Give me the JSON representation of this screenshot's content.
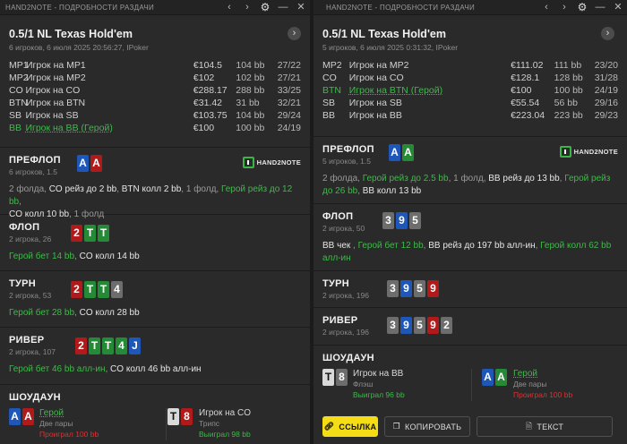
{
  "panels": [
    {
      "title": "HAND2NOTE - ПОДРОБНОСТИ РАЗДАЧИ",
      "game": "0.5/1 NL Texas Hold'em",
      "meta": "6 игроков, 6 июля 2025 20:56:27, IPoker",
      "players": [
        {
          "pos": "MP1",
          "name": "Игрок на MP1",
          "amount": "€104.5",
          "bb": "104 bb",
          "stats": "27/22",
          "hero": false
        },
        {
          "pos": "MP2",
          "name": "Игрок на MP2",
          "amount": "€102",
          "bb": "102 bb",
          "stats": "27/21",
          "hero": false
        },
        {
          "pos": "CO",
          "name": "Игрок на CO",
          "amount": "€288.17",
          "bb": "288 bb",
          "stats": "33/25",
          "hero": false
        },
        {
          "pos": "BTN",
          "name": "Игрок на BTN",
          "amount": "€31.42",
          "bb": "31 bb",
          "stats": "32/21",
          "hero": false
        },
        {
          "pos": "SB",
          "name": "Игрок на SB",
          "amount": "€103.75",
          "bb": "104 bb",
          "stats": "29/24",
          "hero": false
        },
        {
          "pos": "BB",
          "name": "Игрок на BB (Герой)",
          "amount": "€100",
          "bb": "100 bb",
          "stats": "24/19",
          "hero": true
        }
      ],
      "preflop": {
        "title": "ПРЕФЛОП",
        "sub": "6 игроков, 1.5",
        "logo": "HAND2NOTE",
        "hole": [
          "A",
          "A"
        ],
        "actions": [
          "2 фолда, ",
          "CO рейз до 2 bb",
          ", ",
          "BTN колл 2 bb",
          ", 1 фолд, ",
          "Герой рейз до 12 bb",
          ",",
          "CO колл 10 bb",
          ", 1 фолд"
        ]
      },
      "flop": {
        "title": "ФЛОП",
        "sub": "2 игрока, 26",
        "cards": [
          "2",
          "T",
          "T"
        ],
        "actions": [
          "Герой бет 14 bb",
          ", ",
          "CO колл 14 bb"
        ]
      },
      "turn": {
        "title": "ТУРН",
        "sub": "2 игрока, 53",
        "cards": [
          "2",
          "T",
          "T",
          "4"
        ],
        "actions": [
          "Герой бет 28 bb",
          ", ",
          "CO колл 28 bb"
        ]
      },
      "river": {
        "title": "РИВЕР",
        "sub": "2 игрока, 107",
        "cards": [
          "2",
          "T",
          "T",
          "4",
          "J"
        ],
        "actions": [
          "Герой бет 46 bb алл-ин",
          ", ",
          "CO колл 46 bb алл-ин"
        ]
      },
      "showdown": {
        "title": "ШОУДАУН",
        "p1": {
          "cards": [
            "A",
            "A"
          ],
          "name": "Герой",
          "combo": "Две пары",
          "result": "Проиграл 100 bb"
        },
        "p2": {
          "cards": [
            "T",
            "8"
          ],
          "name": "Игрок на CO",
          "combo": "Трипс",
          "result": "Выиграл 98 bb"
        }
      }
    },
    {
      "title": "HAND2NOTE - ПОДРОБНОСТИ РАЗДАЧИ",
      "game": "0.5/1 NL Texas Hold'em",
      "meta": "5 игроков, 6 июля 2025 0:31:32, IPoker",
      "players": [
        {
          "pos": "MP2",
          "name": "Игрок на MP2",
          "amount": "€111.02",
          "bb": "111 bb",
          "stats": "23/20",
          "hero": false
        },
        {
          "pos": "CO",
          "name": "Игрок на CO",
          "amount": "€128.1",
          "bb": "128 bb",
          "stats": "31/28",
          "hero": false
        },
        {
          "pos": "BTN",
          "name": "Игрок на BTN (Герой)",
          "amount": "€100",
          "bb": "100 bb",
          "stats": "24/19",
          "hero": true
        },
        {
          "pos": "SB",
          "name": "Игрок на SB",
          "amount": "€55.54",
          "bb": "56 bb",
          "stats": "29/16",
          "hero": false
        },
        {
          "pos": "BB",
          "name": "Игрок на BB",
          "amount": "€223.04",
          "bb": "223 bb",
          "stats": "29/23",
          "hero": false
        }
      ],
      "preflop": {
        "title": "ПРЕФЛОП",
        "sub": "5 игроков, 1.5",
        "logo": "HAND2NOTE",
        "hole": [
          "A",
          "A"
        ],
        "actions": [
          "2 фолда, ",
          "Герой рейз до 2.5 bb",
          ", 1 фолд, ",
          "BB рейз до 13 bb",
          ", ",
          "Герой рейз до 26 bb",
          ", ",
          "BB колл 13 bb"
        ]
      },
      "flop": {
        "title": "ФЛОП",
        "sub": "2 игрока, 50",
        "cards": [
          "3",
          "9",
          "5"
        ],
        "actions": [
          "BB чек",
          " , ",
          "Герой бет 12 bb",
          ", ",
          "BB рейз до 197 bb алл-ин",
          ", ",
          "Герой колл 62 bb алл-ин"
        ]
      },
      "turn": {
        "title": "ТУРН",
        "sub": "2 игрока, 196",
        "cards": [
          "3",
          "9",
          "5",
          "9"
        ]
      },
      "river": {
        "title": "РИВЕР",
        "sub": "2 игрока, 196",
        "cards": [
          "3",
          "9",
          "5",
          "9",
          "2"
        ]
      },
      "showdown": {
        "title": "ШОУДАУН",
        "p1": {
          "cards": [
            "T",
            "8"
          ],
          "name": "Игрок на BB",
          "combo": "Флэш",
          "result": "Выиграл 96 bb"
        },
        "p2": {
          "cards": [
            "A",
            "A"
          ],
          "name": "Герой",
          "combo": "Две пары",
          "result": "Проиграл 100 bb"
        }
      },
      "buttons": {
        "link": "ССЫЛКА",
        "copy": "КОПИРОВАТЬ",
        "text": "ТЕКСТ"
      }
    }
  ],
  "colors": {
    "hero": "#3dbb48",
    "lost": "#e03030",
    "spade": "#6d6d6d",
    "heart": "#b01a1a",
    "diamond": "#1f57b8",
    "club": "#248a35",
    "link_button": "#f5dd16"
  },
  "icons": [
    "chevron-left-icon",
    "chevron-right-icon",
    "gear-icon",
    "minimize-icon",
    "close-icon",
    "chevron-right-icon",
    "link-icon",
    "copy-icon",
    "document-icon",
    "hand2note-logo-icon"
  ]
}
